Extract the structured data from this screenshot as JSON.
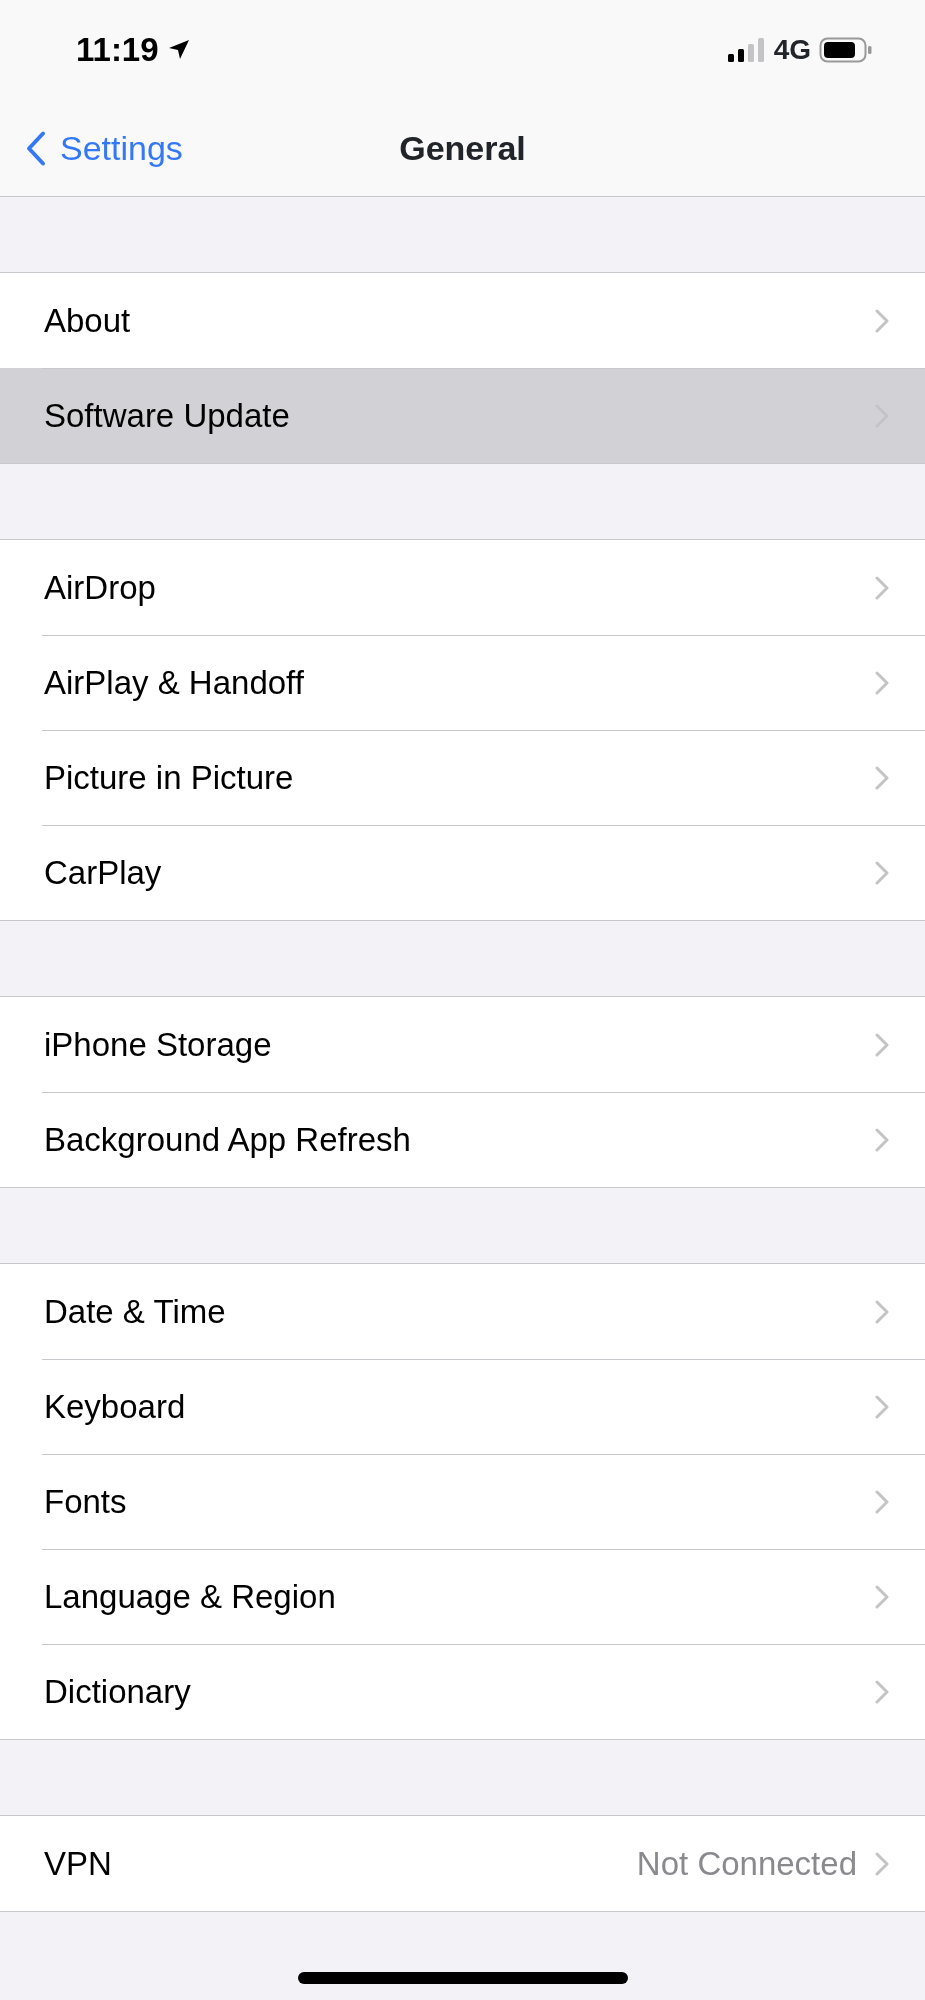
{
  "status_bar": {
    "time": "11:19",
    "network": "4G"
  },
  "nav": {
    "back_label": "Settings",
    "title": "General"
  },
  "groups": [
    {
      "items": [
        {
          "label": "About",
          "selected": false
        },
        {
          "label": "Software Update",
          "selected": true
        }
      ]
    },
    {
      "items": [
        {
          "label": "AirDrop",
          "selected": false
        },
        {
          "label": "AirPlay & Handoff",
          "selected": false
        },
        {
          "label": "Picture in Picture",
          "selected": false
        },
        {
          "label": "CarPlay",
          "selected": false
        }
      ]
    },
    {
      "items": [
        {
          "label": "iPhone Storage",
          "selected": false
        },
        {
          "label": "Background App Refresh",
          "selected": false
        }
      ]
    },
    {
      "items": [
        {
          "label": "Date & Time",
          "selected": false
        },
        {
          "label": "Keyboard",
          "selected": false
        },
        {
          "label": "Fonts",
          "selected": false
        },
        {
          "label": "Language & Region",
          "selected": false
        },
        {
          "label": "Dictionary",
          "selected": false
        }
      ]
    },
    {
      "items": [
        {
          "label": "VPN",
          "value": "Not Connected",
          "selected": false
        }
      ]
    }
  ]
}
